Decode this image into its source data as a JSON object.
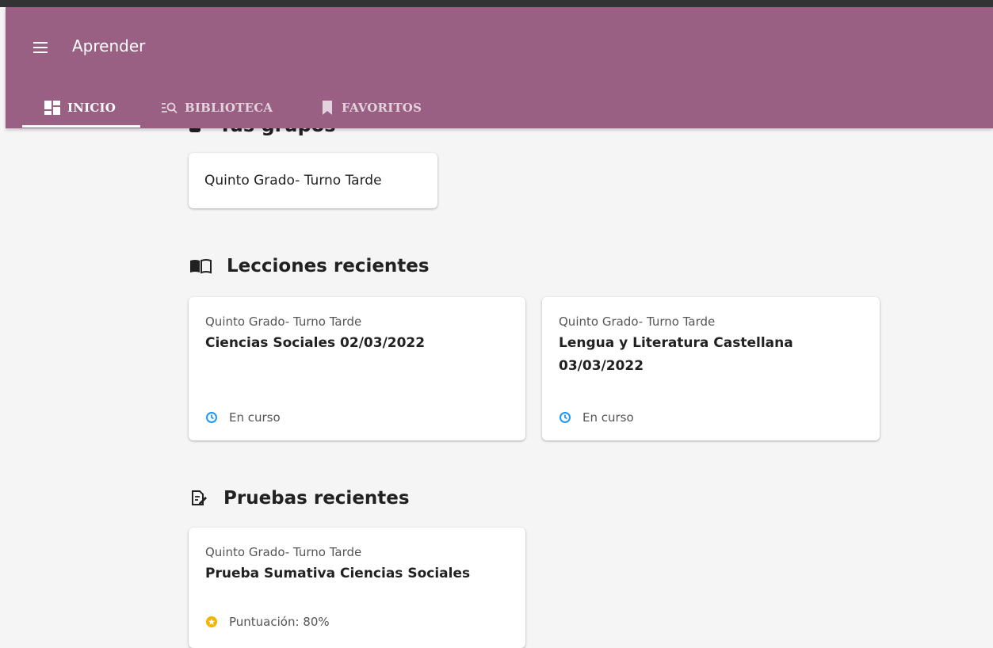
{
  "app": {
    "title": "Aprender",
    "accent_color": "#996084"
  },
  "tabs": [
    {
      "label": "INICIO",
      "icon": "dashboard-icon",
      "active": true
    },
    {
      "label": "BIBLIOTECA",
      "icon": "library-search-icon",
      "active": false
    },
    {
      "label": "FAVORITOS",
      "icon": "bookmark-icon",
      "active": false
    }
  ],
  "groups": {
    "heading": "Tus grupos",
    "items": [
      {
        "name": "Quinto Grado- Turno Tarde"
      }
    ]
  },
  "lessons": {
    "heading": "Lecciones recientes",
    "icon": "book-icon",
    "items": [
      {
        "group": "Quinto Grado- Turno Tarde",
        "title": "Ciencias Sociales 02/03/2022",
        "status": "En curso",
        "status_icon": "clock-icon",
        "status_color": "#2196f3"
      },
      {
        "group": "Quinto Grado- Turno Tarde",
        "title": "Lengua y Literatura Castellana 03/03/2022",
        "status": "En curso",
        "status_icon": "clock-icon",
        "status_color": "#2196f3"
      }
    ]
  },
  "tests": {
    "heading": "Pruebas recientes",
    "icon": "quiz-icon",
    "items": [
      {
        "group": "Quinto Grado- Turno Tarde",
        "title": "Prueba Sumativa Ciencias Sociales",
        "status": "Puntuación: 80%",
        "status_icon": "star-icon",
        "status_color": "#f4b400"
      }
    ]
  }
}
